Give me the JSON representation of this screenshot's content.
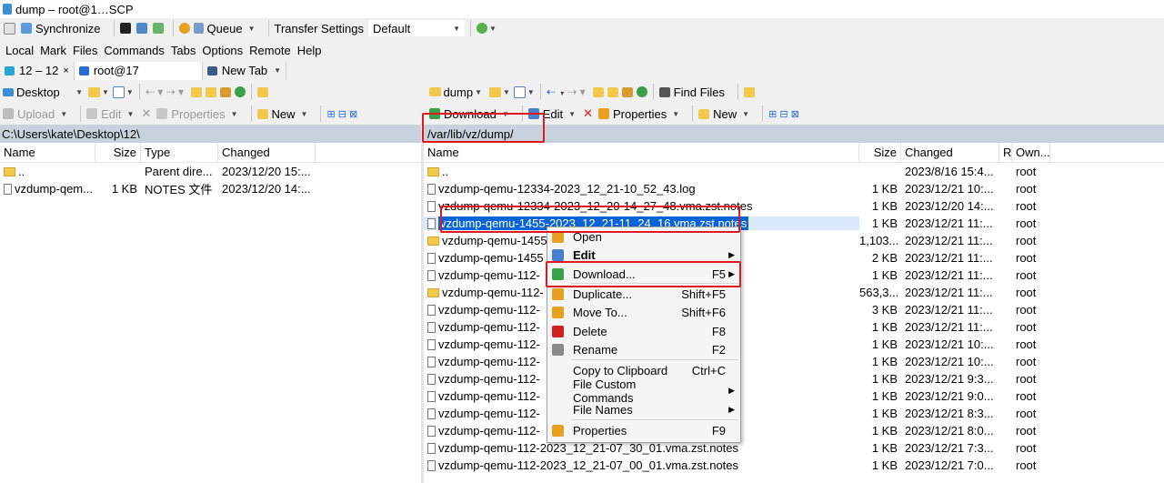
{
  "window": {
    "title": "dump – root@1…SCP"
  },
  "toolbar1": {
    "synchronize": "Synchronize",
    "queue": "Queue",
    "transfer_settings_label": "Transfer Settings",
    "transfer_settings_value": "Default"
  },
  "menu": [
    "Local",
    "Mark",
    "Files",
    "Commands",
    "Tabs",
    "Options",
    "Remote",
    "Help"
  ],
  "tabs": [
    {
      "label": "12 – 12"
    },
    {
      "label": "root@17"
    },
    {
      "label": "New Tab"
    }
  ],
  "left": {
    "location": "Desktop",
    "actions": {
      "upload": "Upload",
      "edit": "Edit",
      "properties": "Properties",
      "new": "New"
    },
    "path": "C:\\Users\\kate\\Desktop\\12\\",
    "columns": [
      "Name",
      "Size",
      "Type",
      "Changed"
    ],
    "rows": [
      {
        "name": "..",
        "size": "",
        "type": "Parent dire...",
        "changed": "2023/12/20 15:..."
      },
      {
        "name": "vzdump-qem...",
        "size": "1 KB",
        "type": "NOTES 文件",
        "changed": "2023/12/20 14:..."
      }
    ]
  },
  "right": {
    "location": "dump",
    "find": "Find Files",
    "actions": {
      "download": "Download",
      "edit": "Edit",
      "properties": "Properties",
      "new": "New"
    },
    "path": "/var/lib/vz/dump/",
    "columns": [
      "Name",
      "Size",
      "Changed",
      "R",
      "Own..."
    ],
    "rows": [
      {
        "name": "..",
        "size": "",
        "changed": "2023/8/16 15:4...",
        "owner": "root",
        "kind": "up"
      },
      {
        "name": "vzdump-qemu-12334-2023_12_21-10_52_43.log",
        "size": "1 KB",
        "changed": "2023/12/21 10:...",
        "owner": "root",
        "kind": "file"
      },
      {
        "name": "vzdump-qemu-12334-2023_12_20-14_27_48.vma.zst.notes",
        "size": "1 KB",
        "changed": "2023/12/20 14:...",
        "owner": "root",
        "kind": "file"
      },
      {
        "name": "vzdump-qemu-1455-2023_12_21-11_24_16.vma.zst.notes",
        "size": "1 KB",
        "changed": "2023/12/21 11:...",
        "owner": "root",
        "kind": "file",
        "selected": true
      },
      {
        "name": "vzdump-qemu-1455",
        "size": "1,103...",
        "changed": "2023/12/21 11:...",
        "owner": "root",
        "kind": "folder"
      },
      {
        "name": "vzdump-qemu-1455",
        "size": "2 KB",
        "changed": "2023/12/21 11:...",
        "owner": "root",
        "kind": "file"
      },
      {
        "name": "vzdump-qemu-112-",
        "size": "1 KB",
        "changed": "2023/12/21 11:...",
        "owner": "root",
        "kind": "file"
      },
      {
        "name": "vzdump-qemu-112-",
        "size": "563,3...",
        "changed": "2023/12/21 11:...",
        "owner": "root",
        "kind": "folder"
      },
      {
        "name": "vzdump-qemu-112-",
        "size": "3 KB",
        "changed": "2023/12/21 11:...",
        "owner": "root",
        "kind": "file"
      },
      {
        "name": "vzdump-qemu-112-",
        "size": "1 KB",
        "changed": "2023/12/21 11:...",
        "owner": "root",
        "kind": "file"
      },
      {
        "name": "vzdump-qemu-112-",
        "size": "1 KB",
        "changed": "2023/12/21 10:...",
        "owner": "root",
        "kind": "file"
      },
      {
        "name": "vzdump-qemu-112-",
        "size": "1 KB",
        "changed": "2023/12/21 10:...",
        "owner": "root",
        "kind": "file"
      },
      {
        "name": "vzdump-qemu-112-",
        "size": "1 KB",
        "changed": "2023/12/21 9:3...",
        "owner": "root",
        "kind": "file"
      },
      {
        "name": "vzdump-qemu-112-",
        "size": "1 KB",
        "changed": "2023/12/21 9:0...",
        "owner": "root",
        "kind": "file"
      },
      {
        "name": "vzdump-qemu-112-",
        "size": "1 KB",
        "changed": "2023/12/21 8:3...",
        "owner": "root",
        "kind": "file"
      },
      {
        "name": "vzdump-qemu-112-",
        "size": "1 KB",
        "changed": "2023/12/21 8:0...",
        "owner": "root",
        "kind": "file"
      },
      {
        "name": "vzdump-qemu-112-2023_12_21-07_30_01.vma.zst.notes",
        "size": "1 KB",
        "changed": "2023/12/21 7:3...",
        "owner": "root",
        "kind": "file"
      },
      {
        "name": "vzdump-qemu-112-2023_12_21-07_00_01.vma.zst.notes",
        "size": "1 KB",
        "changed": "2023/12/21 7:0...",
        "owner": "root",
        "kind": "file"
      }
    ]
  },
  "context_menu": [
    {
      "label": "Open",
      "shortcut": "",
      "bold": false,
      "arrow": false,
      "icon": "open-icon",
      "color": "#e8a020"
    },
    {
      "label": "Edit",
      "shortcut": "",
      "bold": true,
      "arrow": true,
      "icon": "edit-icon",
      "color": "#4a7fd0"
    },
    {
      "label": "Download...",
      "shortcut": "F5",
      "bold": false,
      "arrow": true,
      "icon": "download-icon",
      "color": "#3aa04a"
    },
    {
      "label": "Duplicate...",
      "shortcut": "Shift+F5",
      "bold": false,
      "arrow": false,
      "icon": "duplicate-icon",
      "color": "#e8a020"
    },
    {
      "label": "Move To...",
      "shortcut": "Shift+F6",
      "bold": false,
      "arrow": false,
      "icon": "move-icon",
      "color": "#e8a020"
    },
    {
      "label": "Delete",
      "shortcut": "F8",
      "bold": false,
      "arrow": false,
      "icon": "delete-icon",
      "color": "#d02020"
    },
    {
      "label": "Rename",
      "shortcut": "F2",
      "bold": false,
      "arrow": false,
      "icon": "rename-icon",
      "color": "#8a8a8a"
    },
    {
      "label": "Copy to Clipboard",
      "shortcut": "Ctrl+C",
      "bold": false,
      "arrow": false,
      "icon": "",
      "color": ""
    },
    {
      "label": "File Custom Commands",
      "shortcut": "",
      "bold": false,
      "arrow": true,
      "icon": "",
      "color": ""
    },
    {
      "label": "File Names",
      "shortcut": "",
      "bold": false,
      "arrow": true,
      "icon": "",
      "color": ""
    },
    {
      "label": "Properties",
      "shortcut": "F9",
      "bold": false,
      "arrow": false,
      "icon": "properties-icon",
      "color": "#e8a020"
    }
  ],
  "colors": {
    "accent": "#0a64d6",
    "highlight_border": "#e0191e",
    "path_bar": "#c7d2dd"
  }
}
